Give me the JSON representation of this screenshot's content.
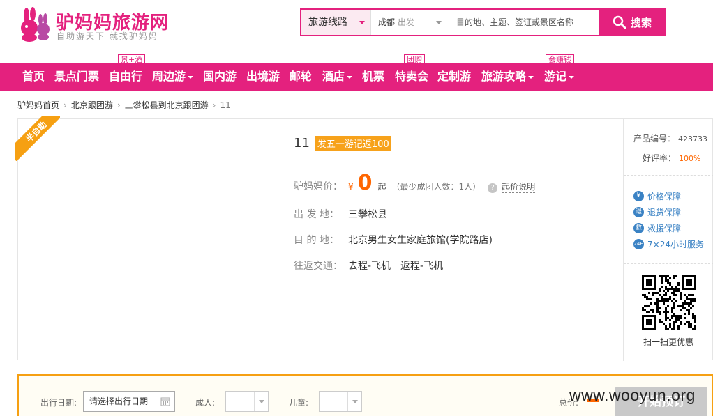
{
  "header": {
    "logo_title": "驴妈妈旅游网",
    "logo_slogan": "自助游天下 就找驴妈妈",
    "search": {
      "type": "旅游线路",
      "city": "成都",
      "city_suffix": "出发",
      "keyword_placeholder": "目的地、主题、签证或景区名称",
      "button": "搜索"
    }
  },
  "nav": {
    "items": [
      {
        "label": "首页",
        "dropdown": false
      },
      {
        "label": "景点门票",
        "dropdown": false
      },
      {
        "label": "自由行",
        "dropdown": false
      },
      {
        "label": "周边游",
        "dropdown": true
      },
      {
        "label": "国内游",
        "dropdown": false
      },
      {
        "label": "出境游",
        "dropdown": false
      },
      {
        "label": "邮轮",
        "dropdown": false
      },
      {
        "label": "酒店",
        "dropdown": true
      },
      {
        "label": "机票",
        "dropdown": false
      },
      {
        "label": "特卖会",
        "dropdown": false
      },
      {
        "label": "定制游",
        "dropdown": false
      },
      {
        "label": "旅游攻略",
        "dropdown": true
      },
      {
        "label": "游记",
        "dropdown": true
      }
    ],
    "tags": {
      "free_travel": "景+酒",
      "sale": "团购",
      "notes": "会赚钱"
    }
  },
  "breadcrumb": [
    "驴妈妈首页",
    "北京跟团游",
    "三攀松县到北京跟团游",
    "11"
  ],
  "product": {
    "ribbon": "半自助",
    "title": "11",
    "promo": "发五一游记返100",
    "price_label": "驴妈妈价：",
    "currency": "¥",
    "price": "0",
    "price_suffix": "起",
    "min_group": "（最少成团人数：1人）",
    "price_explain": "起价说明",
    "depart_label": "出 发 地：",
    "depart": "三攀松县",
    "dest_label": "目 的 地：",
    "dest": "北京男生女生家庭旅馆(学院路店)",
    "traffic_label": "往返交通：",
    "traffic_go": "去程-飞机",
    "traffic_back": "返程-飞机"
  },
  "side": {
    "code_label": "产品编号：",
    "code": "423733",
    "rating_label": "好评率：",
    "rating": "100%",
    "guarantees": [
      {
        "icon": "yen-icon",
        "glyph": "¥",
        "label": "价格保障"
      },
      {
        "icon": "refund-icon",
        "glyph": "退",
        "label": "退货保障"
      },
      {
        "icon": "rescue-icon",
        "glyph": "救",
        "label": "救援保障"
      },
      {
        "icon": "24h-icon",
        "glyph": "24H",
        "label": "7×24小时服务"
      }
    ],
    "qr_caption": "扫一扫更优惠"
  },
  "booking": {
    "date_label": "出行日期:",
    "date_placeholder": "请选择出行日期",
    "adult_label": "成人:",
    "child_label": "儿童:",
    "total_label": "总价:",
    "button": "开始预订"
  },
  "watermark": "www.wooyun.org",
  "colors": {
    "brand": "#e4217e",
    "accent_orange": "#f60",
    "ribbon": "#f6a012",
    "link_blue": "#3a82c4"
  }
}
